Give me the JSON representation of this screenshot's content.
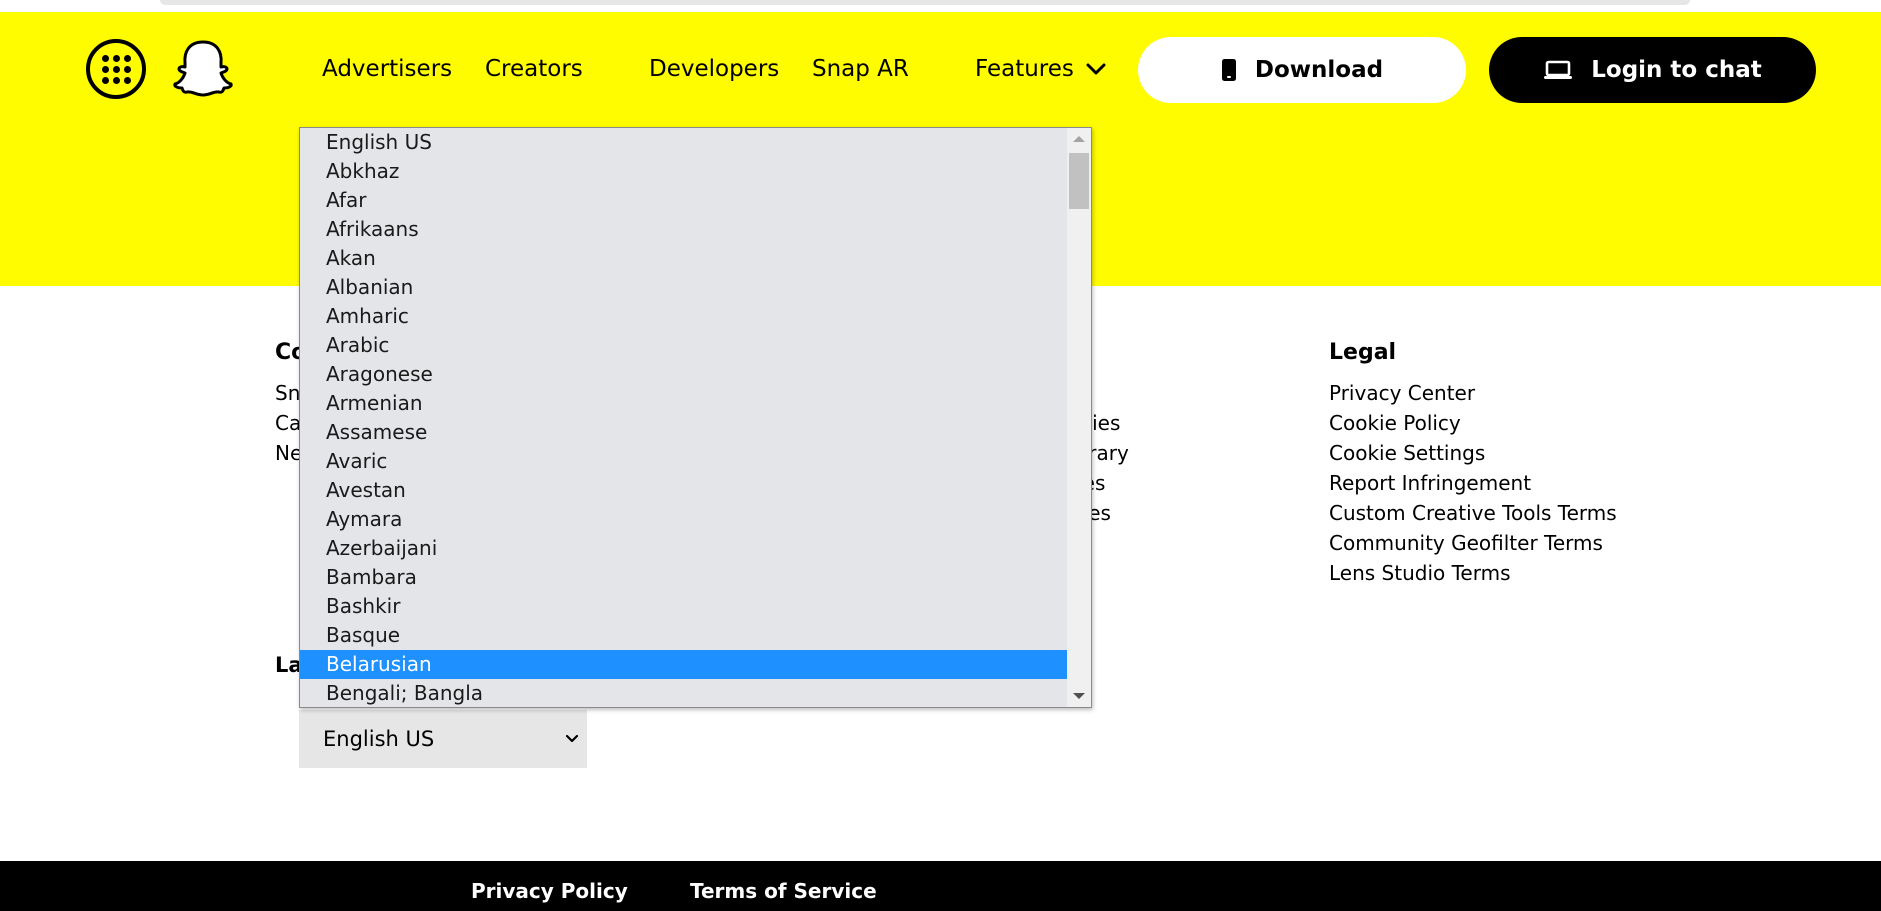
{
  "header": {
    "nav": [
      {
        "label": "Advertisers"
      },
      {
        "label": "Creators"
      },
      {
        "label": "Developers"
      },
      {
        "label": "Snap AR"
      },
      {
        "label": "Features"
      }
    ],
    "download_label": "Download",
    "login_label": "Login to chat"
  },
  "company": {
    "heading_partial": "Co",
    "links_partial": [
      "Sn",
      "Ca",
      "Ne"
    ]
  },
  "middle": {
    "links_partial": [
      "licies",
      "ibrary",
      "nes",
      "ules"
    ]
  },
  "legal": {
    "heading": "Legal",
    "links": [
      "Privacy Center",
      "Cookie Policy",
      "Cookie Settings",
      "Report Infringement",
      "Custom Creative Tools Terms",
      "Community Geofilter Terms",
      "Lens Studio Terms"
    ]
  },
  "language": {
    "heading_partial": "La",
    "selected_value": "English US",
    "highlighted_option": "Belarusian",
    "options": [
      "English US",
      "Abkhaz",
      "Afar",
      "Afrikaans",
      "Akan",
      "Albanian",
      "Amharic",
      "Arabic",
      "Aragonese",
      "Armenian",
      "Assamese",
      "Avaric",
      "Avestan",
      "Aymara",
      "Azerbaijani",
      "Bambara",
      "Bashkir",
      "Basque",
      "Belarusian",
      "Bengali; Bangla"
    ]
  },
  "footer": {
    "privacy_label": "Privacy Policy",
    "terms_label": "Terms of Service"
  },
  "colors": {
    "brand_yellow": "#FFFC00",
    "highlight_blue": "#1E90FF",
    "black": "#000000"
  },
  "icons": [
    "grid-menu-icon",
    "snapchat-ghost-icon",
    "chevron-down-icon",
    "phone-icon",
    "laptop-icon",
    "scroll-up-arrow-icon",
    "scroll-down-arrow-icon"
  ]
}
